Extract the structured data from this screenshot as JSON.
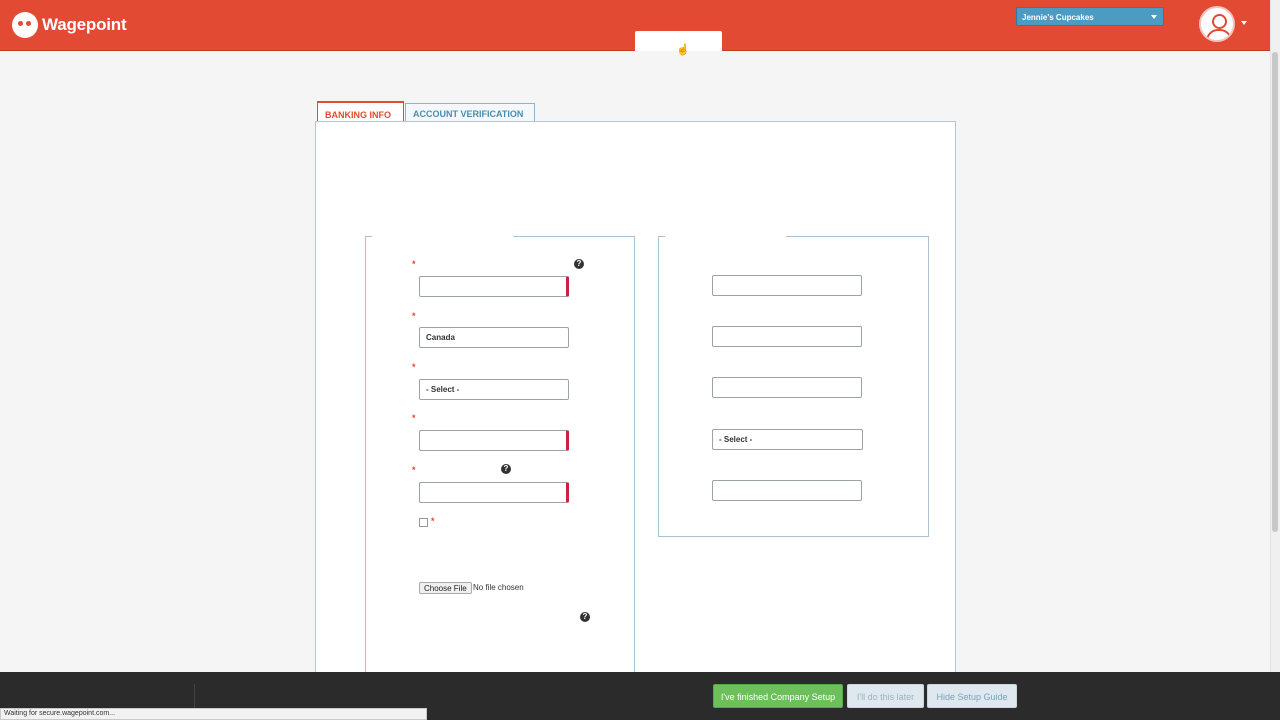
{
  "header": {
    "logo_text": "Wagepoint",
    "company_name": "Jennie's Cupcakes"
  },
  "tabs": [
    {
      "label": "BANKING INFO",
      "active": true
    },
    {
      "label": "ACCOUNT VERIFICATION",
      "active": false
    }
  ],
  "left_form": {
    "country_value": "Canada",
    "select_placeholder": "- Select -",
    "file_button_label": "Choose File",
    "file_status": "No file chosen"
  },
  "right_form": {
    "select_placeholder": "- Select -"
  },
  "footer": {
    "finished_label": "I've finished Company Setup",
    "later_label": "I'll do this later",
    "hide_label": "Hide Setup Guide"
  },
  "browser_status": "Waiting for secure.wagepoint.com...",
  "colors": {
    "brand": "#e24a33",
    "accent_blue": "#4b9bc3",
    "success": "#6cbf5b",
    "required_marker": "#c9243f"
  },
  "icons": {
    "help": "question-circle-icon",
    "cursor": "hand-pointer-icon",
    "avatar": "user-avatar-icon"
  }
}
